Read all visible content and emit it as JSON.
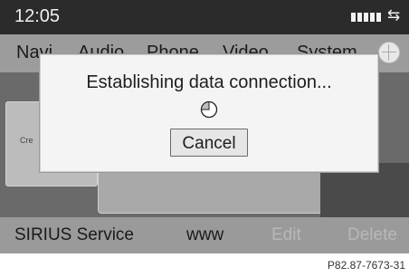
{
  "status": {
    "time": "12:05",
    "arrows_icon": "sync-arrows-icon"
  },
  "menu": {
    "items": [
      "Navi",
      "Audio",
      "Phone",
      "Video",
      "System"
    ]
  },
  "background": {
    "panel_text": "Cre"
  },
  "dialog": {
    "message": "Establishing data connection...",
    "cancel_label": "Cancel"
  },
  "bottom": {
    "items": [
      {
        "label": "SIRIUS Service",
        "state": "active"
      },
      {
        "label": "www",
        "state": "active"
      },
      {
        "label": "Edit",
        "state": "disabled"
      },
      {
        "label": "Delete",
        "state": "disabled"
      }
    ]
  },
  "footer": {
    "reference": "P82.87-7673-31"
  }
}
